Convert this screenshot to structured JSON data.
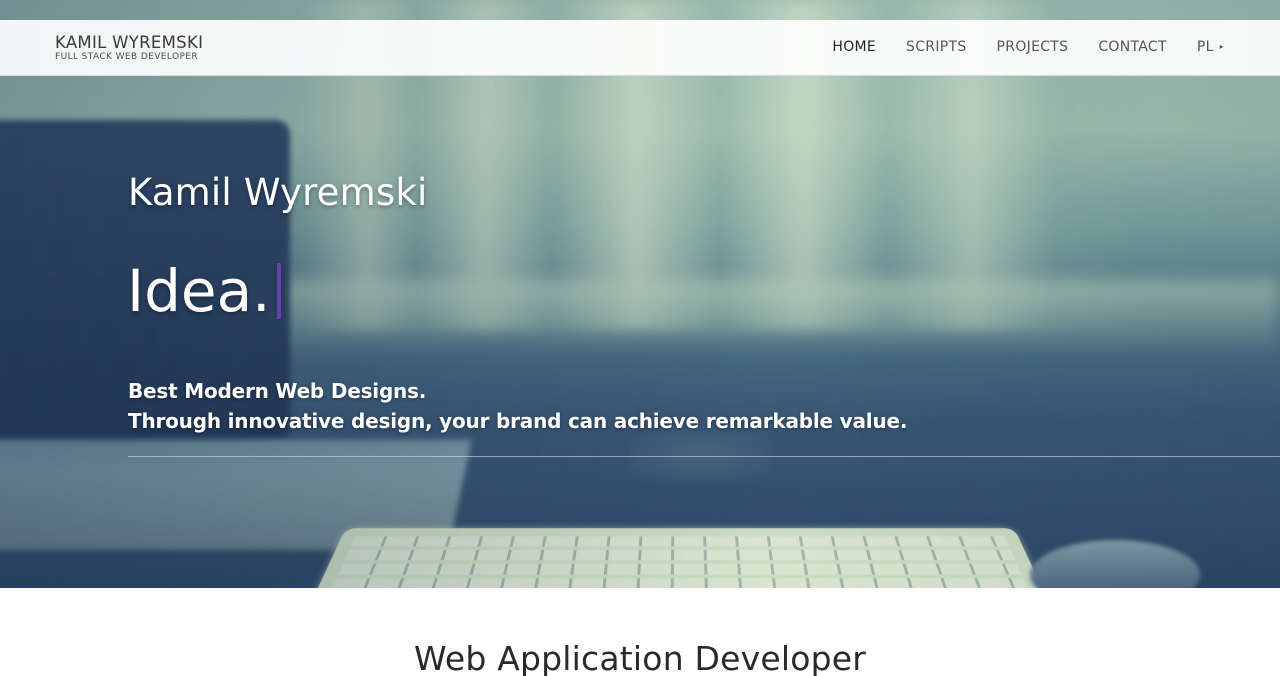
{
  "brand": {
    "name": "KAMIL WYREMSKI",
    "subtitle": "FULL STACK WEB DEVELOPER"
  },
  "nav": {
    "items": [
      {
        "label": "HOME",
        "active": true
      },
      {
        "label": "SCRIPTS",
        "active": false
      },
      {
        "label": "PROJECTS",
        "active": false
      },
      {
        "label": "CONTACT",
        "active": false
      }
    ],
    "language": {
      "label": "PL",
      "icon": "caret-right-icon"
    }
  },
  "hero": {
    "name": "Kamil Wyremski",
    "typed_text": "Idea.",
    "cursor_color": "#6a3fb0",
    "tagline_lines": [
      "Best Modern Web Designs.",
      "Through innovative design, your brand can achieve remarkable value."
    ]
  },
  "section": {
    "title": "Web Application Developer"
  }
}
